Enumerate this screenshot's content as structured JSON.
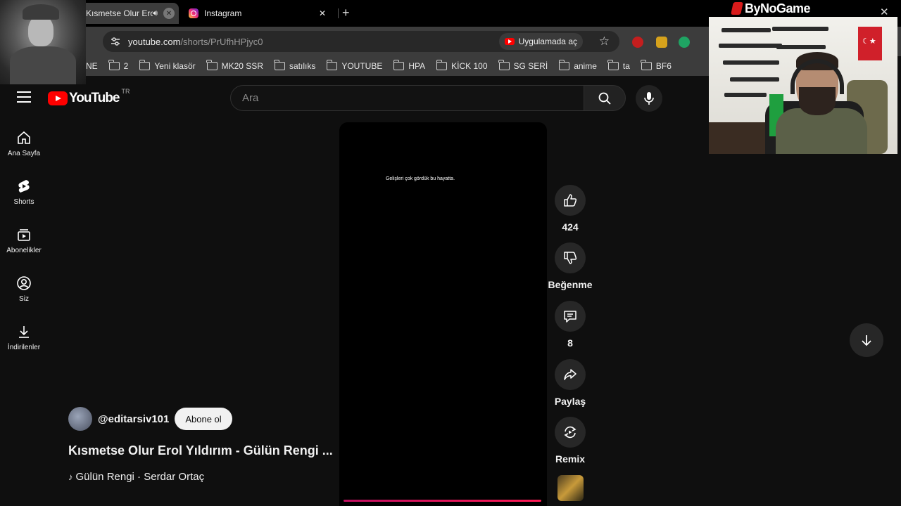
{
  "browser": {
    "tabs": [
      {
        "title": "Kısmetse Olur Erol Yıldırım",
        "active": true
      },
      {
        "title": "Instagram",
        "active": false
      }
    ],
    "url_host": "youtube.com",
    "url_path": "/shorts/PrUfhHPjyc0",
    "open_in_app_label": "Uygulamada aç",
    "bookmarks": [
      "NE",
      "2",
      "Yeni klasör",
      "MK20 SSR",
      "satılıks",
      "YOUTUBE",
      "HPA",
      "KİCK 100",
      "SG SERİ",
      "anime",
      "ta",
      "BF6"
    ]
  },
  "overlay": {
    "brand": "ByNoGame"
  },
  "youtube": {
    "logo_text": "YouTube",
    "country_code": "TR",
    "search_placeholder": "Ara",
    "sidebar": [
      {
        "label": "Ana Sayfa",
        "icon": "home-icon"
      },
      {
        "label": "Shorts",
        "icon": "shorts-icon"
      },
      {
        "label": "Abonelikler",
        "icon": "subscriptions-icon"
      },
      {
        "label": "Siz",
        "icon": "you-icon"
      },
      {
        "label": "İndirilenler",
        "icon": "download-icon"
      }
    ],
    "short": {
      "caption": "Gelişleri çok gördük bu hayatta.",
      "progress": 1.0,
      "channel": "@editarsiv101",
      "subscribe_label": "Abone ol",
      "title": "Kısmetse Olur Erol Yıldırım - Gülün Rengi ...",
      "music": "Gülün Rengi · Serdar Ortaç"
    },
    "actions": {
      "like_count": "424",
      "dislike_label": "Beğenme",
      "comment_count": "8",
      "share_label": "Paylaş",
      "remix_label": "Remix"
    }
  }
}
